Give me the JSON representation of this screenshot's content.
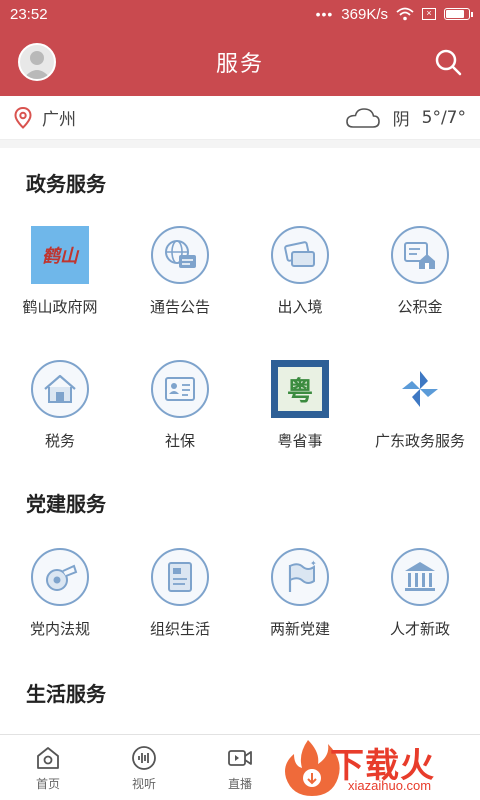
{
  "status_bar": {
    "time": "23:52",
    "net_speed": "369K/s"
  },
  "header": {
    "title": "服务"
  },
  "location": {
    "city": "广州",
    "weather": "阴",
    "temperature": "5°/7°"
  },
  "sections": [
    {
      "title": "政务服务",
      "items": [
        {
          "label": "鹤山政府网",
          "icon": "heshan-logo-icon",
          "logo_text": "鹤山"
        },
        {
          "label": "通告公告",
          "icon": "announcement-icon"
        },
        {
          "label": "出入境",
          "icon": "passport-cards-icon"
        },
        {
          "label": "公积金",
          "icon": "housing-fund-icon"
        },
        {
          "label": "税务",
          "icon": "tax-house-icon"
        },
        {
          "label": "社保",
          "icon": "social-security-card-icon"
        },
        {
          "label": "粤省事",
          "icon": "yueshengshi-logo-icon",
          "logo_text": "粤"
        },
        {
          "label": "广东政务服务",
          "icon": "pinwheel-logo-icon"
        }
      ]
    },
    {
      "title": "党建服务",
      "items": [
        {
          "label": "党内法规",
          "icon": "whistle-icon"
        },
        {
          "label": "组织生活",
          "icon": "document-icon"
        },
        {
          "label": "两新党建",
          "icon": "flag-icon"
        },
        {
          "label": "人才新政",
          "icon": "institution-icon"
        }
      ]
    },
    {
      "title": "生活服务",
      "items": []
    }
  ],
  "bottom_nav": [
    {
      "label": "首页",
      "icon": "home-icon"
    },
    {
      "label": "视听",
      "icon": "audio-icon"
    },
    {
      "label": "直播",
      "icon": "live-video-icon"
    }
  ],
  "watermark": {
    "text": "下载火",
    "url": "xiazaihuo.com"
  },
  "colors": {
    "brand": "#c94a4f",
    "icon_stroke": "#7ea3cc",
    "watermark": "#e83c2b"
  }
}
